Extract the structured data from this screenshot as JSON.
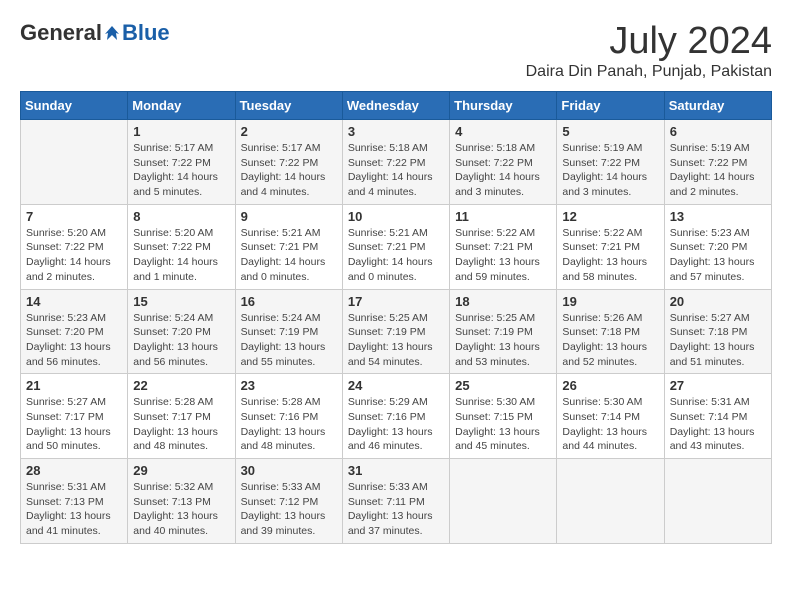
{
  "header": {
    "logo": {
      "general": "General",
      "blue": "Blue"
    },
    "title": "July 2024",
    "location": "Daira Din Panah, Punjab, Pakistan"
  },
  "weekdays": [
    "Sunday",
    "Monday",
    "Tuesday",
    "Wednesday",
    "Thursday",
    "Friday",
    "Saturday"
  ],
  "weeks": [
    [
      {
        "day": "",
        "info": ""
      },
      {
        "day": "1",
        "info": "Sunrise: 5:17 AM\nSunset: 7:22 PM\nDaylight: 14 hours\nand 5 minutes."
      },
      {
        "day": "2",
        "info": "Sunrise: 5:17 AM\nSunset: 7:22 PM\nDaylight: 14 hours\nand 4 minutes."
      },
      {
        "day": "3",
        "info": "Sunrise: 5:18 AM\nSunset: 7:22 PM\nDaylight: 14 hours\nand 4 minutes."
      },
      {
        "day": "4",
        "info": "Sunrise: 5:18 AM\nSunset: 7:22 PM\nDaylight: 14 hours\nand 3 minutes."
      },
      {
        "day": "5",
        "info": "Sunrise: 5:19 AM\nSunset: 7:22 PM\nDaylight: 14 hours\nand 3 minutes."
      },
      {
        "day": "6",
        "info": "Sunrise: 5:19 AM\nSunset: 7:22 PM\nDaylight: 14 hours\nand 2 minutes."
      }
    ],
    [
      {
        "day": "7",
        "info": "Sunrise: 5:20 AM\nSunset: 7:22 PM\nDaylight: 14 hours\nand 2 minutes."
      },
      {
        "day": "8",
        "info": "Sunrise: 5:20 AM\nSunset: 7:22 PM\nDaylight: 14 hours\nand 1 minute."
      },
      {
        "day": "9",
        "info": "Sunrise: 5:21 AM\nSunset: 7:21 PM\nDaylight: 14 hours\nand 0 minutes."
      },
      {
        "day": "10",
        "info": "Sunrise: 5:21 AM\nSunset: 7:21 PM\nDaylight: 14 hours\nand 0 minutes."
      },
      {
        "day": "11",
        "info": "Sunrise: 5:22 AM\nSunset: 7:21 PM\nDaylight: 13 hours\nand 59 minutes."
      },
      {
        "day": "12",
        "info": "Sunrise: 5:22 AM\nSunset: 7:21 PM\nDaylight: 13 hours\nand 58 minutes."
      },
      {
        "day": "13",
        "info": "Sunrise: 5:23 AM\nSunset: 7:20 PM\nDaylight: 13 hours\nand 57 minutes."
      }
    ],
    [
      {
        "day": "14",
        "info": "Sunrise: 5:23 AM\nSunset: 7:20 PM\nDaylight: 13 hours\nand 56 minutes."
      },
      {
        "day": "15",
        "info": "Sunrise: 5:24 AM\nSunset: 7:20 PM\nDaylight: 13 hours\nand 56 minutes."
      },
      {
        "day": "16",
        "info": "Sunrise: 5:24 AM\nSunset: 7:19 PM\nDaylight: 13 hours\nand 55 minutes."
      },
      {
        "day": "17",
        "info": "Sunrise: 5:25 AM\nSunset: 7:19 PM\nDaylight: 13 hours\nand 54 minutes."
      },
      {
        "day": "18",
        "info": "Sunrise: 5:25 AM\nSunset: 7:19 PM\nDaylight: 13 hours\nand 53 minutes."
      },
      {
        "day": "19",
        "info": "Sunrise: 5:26 AM\nSunset: 7:18 PM\nDaylight: 13 hours\nand 52 minutes."
      },
      {
        "day": "20",
        "info": "Sunrise: 5:27 AM\nSunset: 7:18 PM\nDaylight: 13 hours\nand 51 minutes."
      }
    ],
    [
      {
        "day": "21",
        "info": "Sunrise: 5:27 AM\nSunset: 7:17 PM\nDaylight: 13 hours\nand 50 minutes."
      },
      {
        "day": "22",
        "info": "Sunrise: 5:28 AM\nSunset: 7:17 PM\nDaylight: 13 hours\nand 48 minutes."
      },
      {
        "day": "23",
        "info": "Sunrise: 5:28 AM\nSunset: 7:16 PM\nDaylight: 13 hours\nand 48 minutes."
      },
      {
        "day": "24",
        "info": "Sunrise: 5:29 AM\nSunset: 7:16 PM\nDaylight: 13 hours\nand 46 minutes."
      },
      {
        "day": "25",
        "info": "Sunrise: 5:30 AM\nSunset: 7:15 PM\nDaylight: 13 hours\nand 45 minutes."
      },
      {
        "day": "26",
        "info": "Sunrise: 5:30 AM\nSunset: 7:14 PM\nDaylight: 13 hours\nand 44 minutes."
      },
      {
        "day": "27",
        "info": "Sunrise: 5:31 AM\nSunset: 7:14 PM\nDaylight: 13 hours\nand 43 minutes."
      }
    ],
    [
      {
        "day": "28",
        "info": "Sunrise: 5:31 AM\nSunset: 7:13 PM\nDaylight: 13 hours\nand 41 minutes."
      },
      {
        "day": "29",
        "info": "Sunrise: 5:32 AM\nSunset: 7:13 PM\nDaylight: 13 hours\nand 40 minutes."
      },
      {
        "day": "30",
        "info": "Sunrise: 5:33 AM\nSunset: 7:12 PM\nDaylight: 13 hours\nand 39 minutes."
      },
      {
        "day": "31",
        "info": "Sunrise: 5:33 AM\nSunset: 7:11 PM\nDaylight: 13 hours\nand 37 minutes."
      },
      {
        "day": "",
        "info": ""
      },
      {
        "day": "",
        "info": ""
      },
      {
        "day": "",
        "info": ""
      }
    ]
  ]
}
